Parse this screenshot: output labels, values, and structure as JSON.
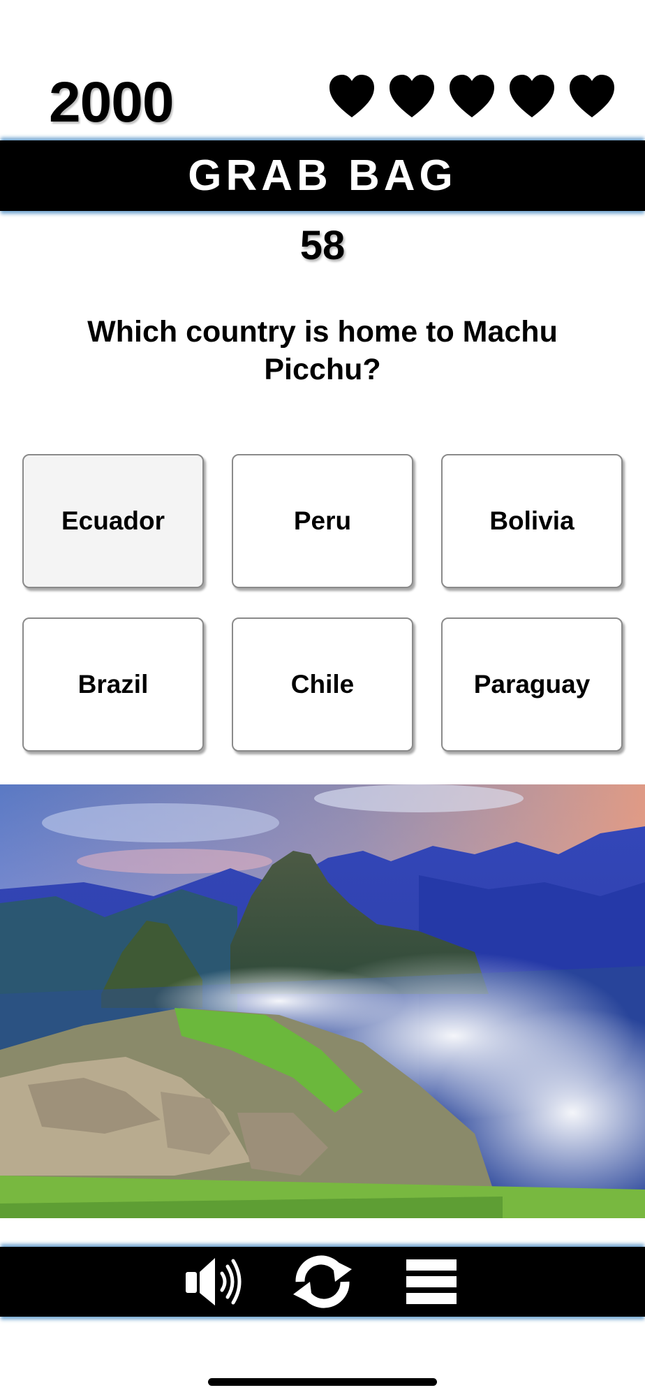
{
  "hud": {
    "score": "2000",
    "lives": 5,
    "heart_icon": "heart-icon"
  },
  "header": {
    "title": "GRAB BAG"
  },
  "timer": {
    "value": "58"
  },
  "question": {
    "text": "Which country is home to Machu Picchu?"
  },
  "answers": [
    {
      "label": "Ecuador",
      "selected": true
    },
    {
      "label": "Peru",
      "selected": false
    },
    {
      "label": "Bolivia",
      "selected": false
    },
    {
      "label": "Brazil",
      "selected": false
    },
    {
      "label": "Chile",
      "selected": false
    },
    {
      "label": "Paraguay",
      "selected": false
    }
  ],
  "image": {
    "subject": "Machu Picchu ruins with mountains and clouds"
  },
  "toolbar": {
    "icons": [
      "speaker-icon",
      "refresh-icon",
      "menu-icon"
    ]
  },
  "colors": {
    "band": "#000000",
    "band_glow": "#5c96c8",
    "text": "#000000",
    "title_text": "#ffffff"
  }
}
